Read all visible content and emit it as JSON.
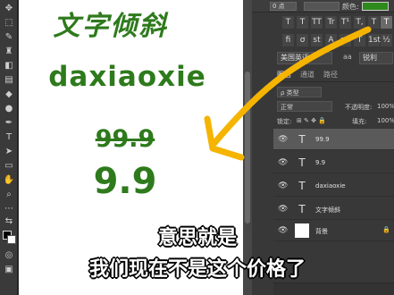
{
  "canvas": {
    "title_text": "文字倾斜",
    "word_text": "daxiaoxie",
    "old_price": "99.9",
    "new_price": "9.9"
  },
  "options_bar": {
    "font_size": "0 点",
    "color_label": "颜色:",
    "color_value": "#2f8a1c"
  },
  "type_styles": [
    "T",
    "T",
    "TT",
    "Tr",
    "T¹",
    "T,",
    "T",
    "T"
  ],
  "language": {
    "value": "美国英语",
    "aa_label": "aa",
    "aa_value": "锐利"
  },
  "layers_panel": {
    "tabs": [
      "图层",
      "通道",
      "路径"
    ],
    "filter_label": "ρ 类型",
    "blend_mode": "正常",
    "opacity_label": "不透明度:",
    "opacity_value": "100%",
    "lock_label": "锁定:",
    "fill_label": "填充:",
    "fill_value": "100%",
    "layers": [
      {
        "name": "99.9",
        "type": "text",
        "selected": true
      },
      {
        "name": "9.9",
        "type": "text",
        "selected": false
      },
      {
        "name": "daxiaoxie",
        "type": "text",
        "selected": false
      },
      {
        "name": "文字倾斜",
        "type": "text",
        "selected": false
      },
      {
        "name": "背景",
        "type": "background",
        "selected": false
      }
    ]
  },
  "subtitles": {
    "line1": "意思就是",
    "line2": "我们现在不是这个价格了"
  },
  "annotation_color": "#f5b400"
}
